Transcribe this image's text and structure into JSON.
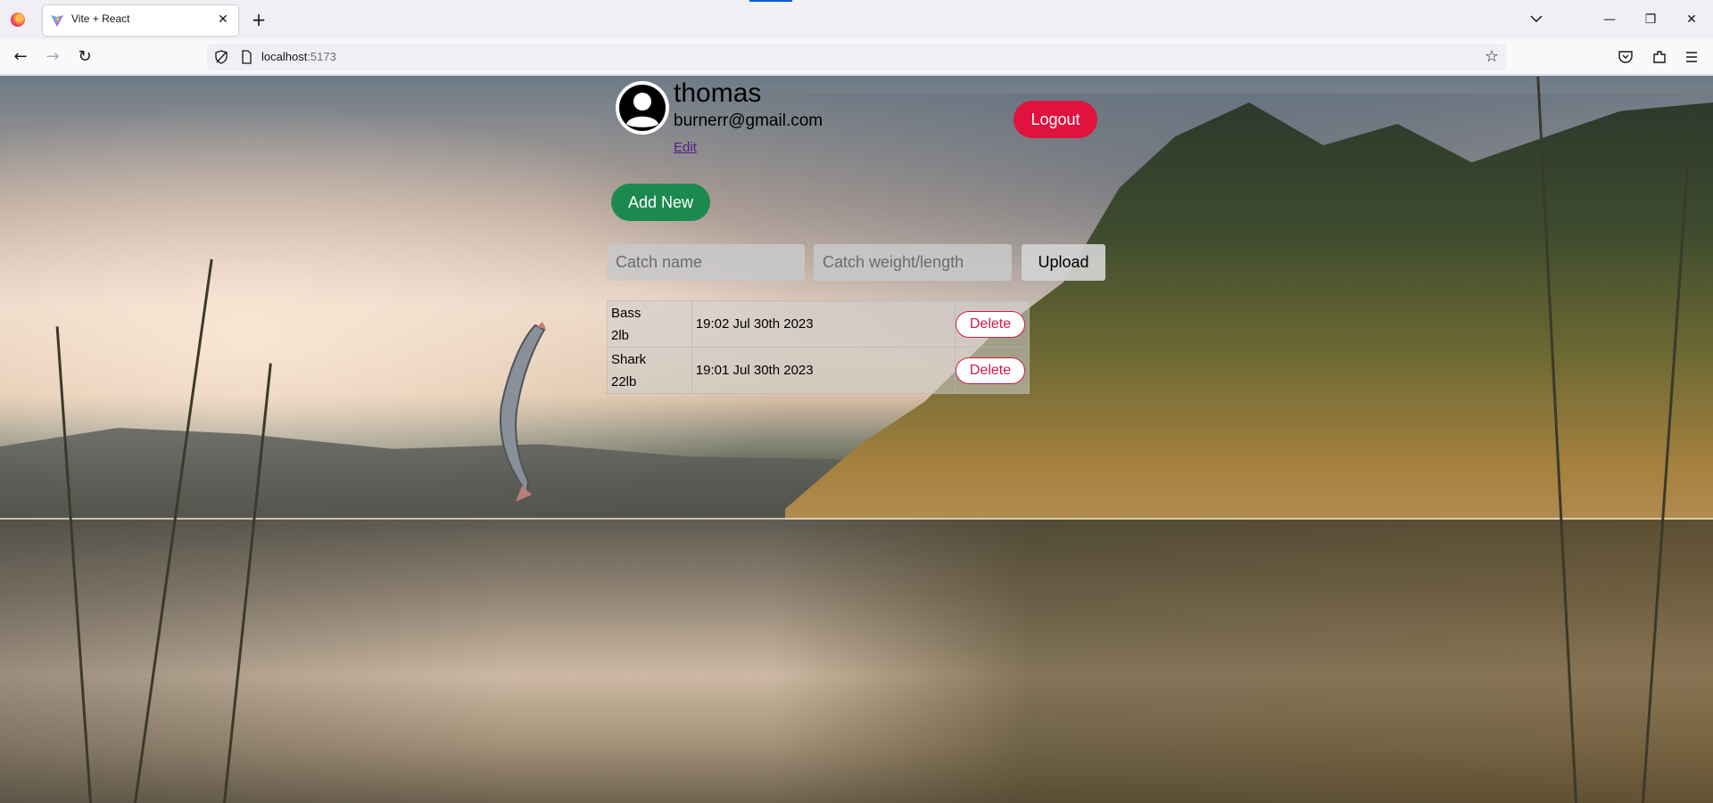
{
  "browser": {
    "tab_title": "Vite + React",
    "url_host": "localhost",
    "url_port": ":5173"
  },
  "profile": {
    "username": "thomas",
    "email": "burnerr@gmail.com",
    "edit_label": "Edit",
    "logout_label": "Logout"
  },
  "actions": {
    "add_new_label": "Add New"
  },
  "form": {
    "name_placeholder": "Catch name",
    "weight_placeholder": "Catch weight/length",
    "upload_label": "Upload"
  },
  "catches": [
    {
      "name": "Bass",
      "size": "2lb",
      "time": "19:02 Jul 30th 2023",
      "delete_label": "Delete"
    },
    {
      "name": "Shark",
      "size": "22lb",
      "time": "19:01 Jul 30th 2023",
      "delete_label": "Delete"
    }
  ],
  "colors": {
    "logout": "#e0123e",
    "add_new": "#1c8a4f",
    "delete": "#d11a45"
  }
}
